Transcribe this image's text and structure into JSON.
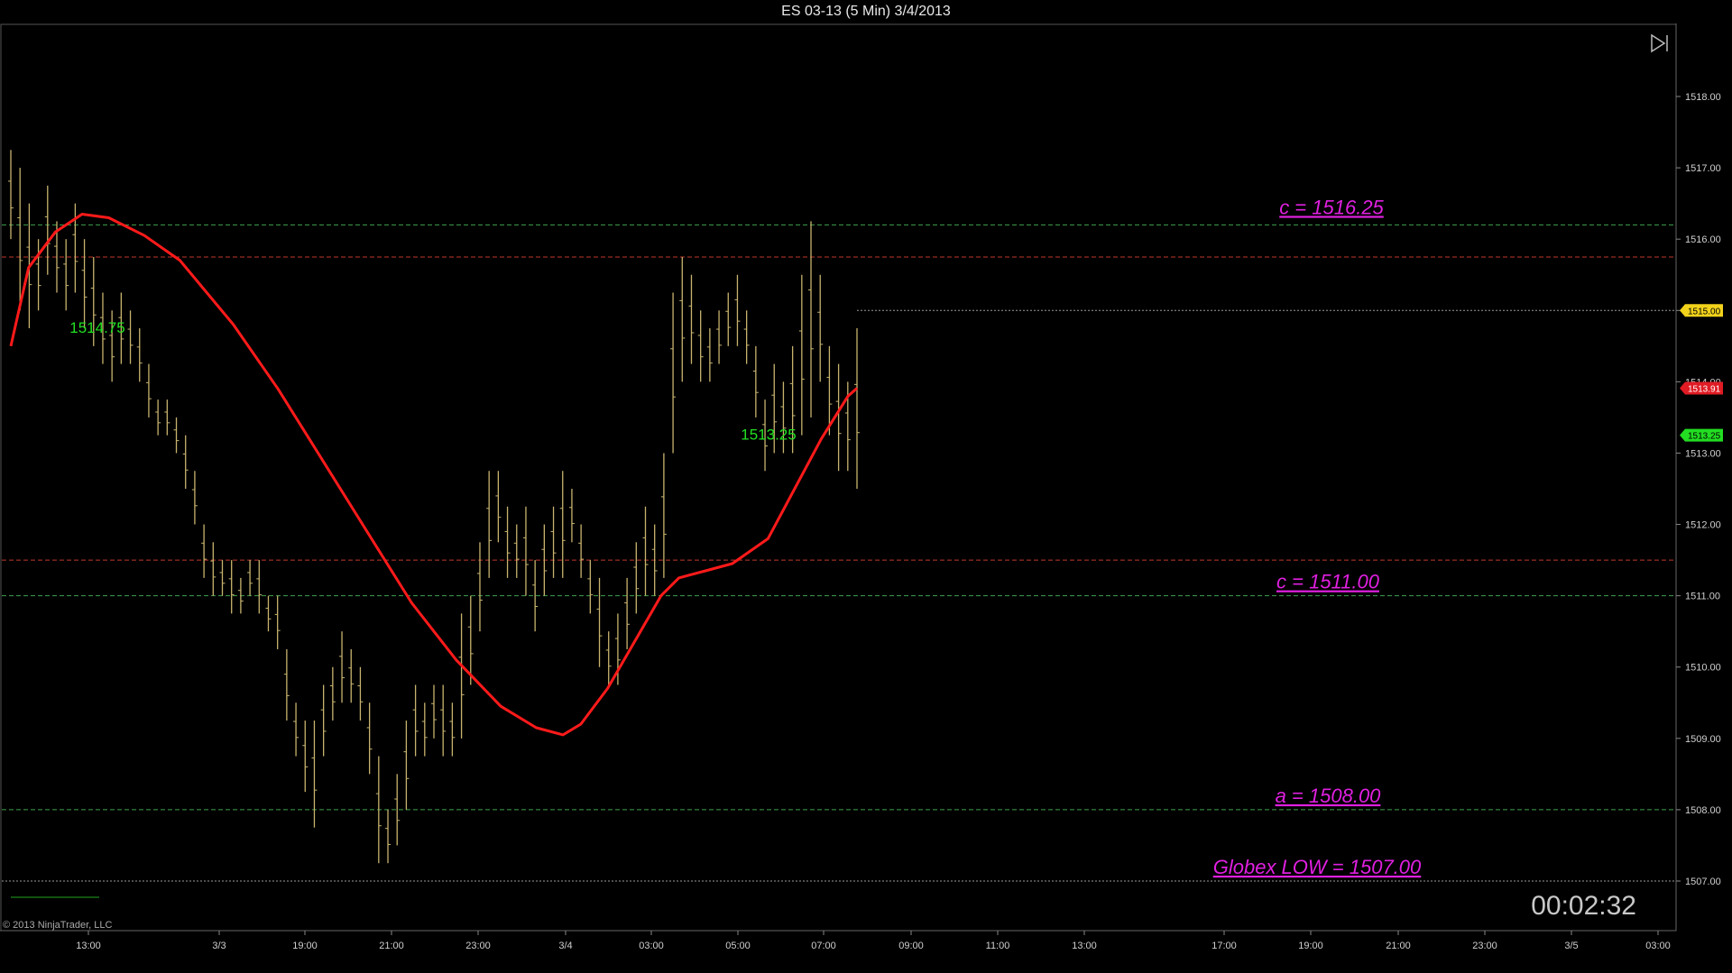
{
  "window": {
    "title": "ES 03-13 (5 Min)  3/4/2013"
  },
  "clock": "00:02:32",
  "copyright": "© 2013 NinjaTrader, LLC",
  "colors": {
    "background": "#000000",
    "bars": "#c8b46e",
    "ma": "#ff1a1a",
    "green_line": "#3fa34d",
    "red_line": "#c0392b",
    "annotation": "#e020e0",
    "value_label": "#22e022",
    "price_tag_last": "#f2d21b",
    "price_tag_ma": "#e01b24",
    "price_tag_green": "#22dd22"
  },
  "icons": {
    "nav": "skip-to-end-icon"
  },
  "chart_data": {
    "type": "bar",
    "instrument": "ES 03-13",
    "interval": "5 Min",
    "ylim": [
      1506.3,
      1518.7
    ],
    "y_ticks": [
      "1507.00",
      "1508.00",
      "1509.00",
      "1510.00",
      "1511.00",
      "1512.00",
      "1513.00",
      "1514.00",
      "1515.00",
      "1516.00",
      "1517.00",
      "1518.00"
    ],
    "x_ticks": [
      "13:00",
      "3/3",
      "19:00",
      "21:00",
      "23:00",
      "3/4",
      "03:00",
      "05:00",
      "07:00",
      "09:00",
      "11:00",
      "13:00",
      "17:00",
      "19:00",
      "21:00",
      "23:00",
      "3/5",
      "03:00"
    ],
    "price_bars_sketch": [
      [
        1517.25,
        1516.0
      ],
      [
        1517.0,
        1515.0
      ],
      [
        1516.5,
        1514.75
      ],
      [
        1516.0,
        1515.0
      ],
      [
        1516.75,
        1515.5
      ],
      [
        1516.25,
        1515.25
      ],
      [
        1516.0,
        1515.0
      ],
      [
        1516.5,
        1515.25
      ],
      [
        1516.0,
        1514.75
      ],
      [
        1515.75,
        1514.5
      ],
      [
        1515.25,
        1514.25
      ],
      [
        1515.0,
        1514.0
      ],
      [
        1515.25,
        1514.25
      ],
      [
        1515.0,
        1514.25
      ],
      [
        1514.75,
        1514.0
      ],
      [
        1514.25,
        1513.5
      ],
      [
        1513.75,
        1513.25
      ],
      [
        1513.75,
        1513.25
      ],
      [
        1513.5,
        1513.0
      ],
      [
        1513.25,
        1512.5
      ],
      [
        1512.75,
        1512.0
      ],
      [
        1512.0,
        1511.25
      ],
      [
        1511.75,
        1511.0
      ],
      [
        1511.5,
        1511.0
      ],
      [
        1511.5,
        1510.75
      ],
      [
        1511.25,
        1510.75
      ],
      [
        1511.5,
        1511.0
      ],
      [
        1511.5,
        1510.75
      ],
      [
        1511.0,
        1510.5
      ],
      [
        1511.0,
        1510.25
      ],
      [
        1510.25,
        1509.25
      ],
      [
        1509.5,
        1508.75
      ],
      [
        1509.25,
        1508.25
      ],
      [
        1509.25,
        1507.75
      ],
      [
        1509.75,
        1508.75
      ],
      [
        1510.0,
        1509.25
      ],
      [
        1510.5,
        1509.5
      ],
      [
        1510.25,
        1509.5
      ],
      [
        1510.0,
        1509.25
      ],
      [
        1509.5,
        1508.5
      ],
      [
        1508.75,
        1507.25
      ],
      [
        1508.0,
        1507.25
      ],
      [
        1508.5,
        1507.5
      ],
      [
        1509.25,
        1508.0
      ],
      [
        1509.75,
        1508.75
      ],
      [
        1509.5,
        1508.75
      ],
      [
        1509.75,
        1509.0
      ],
      [
        1509.75,
        1508.75
      ],
      [
        1509.5,
        1508.75
      ],
      [
        1510.75,
        1509.0
      ],
      [
        1511.0,
        1509.75
      ],
      [
        1511.75,
        1510.5
      ],
      [
        1512.75,
        1511.25
      ],
      [
        1512.75,
        1511.75
      ],
      [
        1512.25,
        1511.25
      ],
      [
        1512.0,
        1511.25
      ],
      [
        1512.25,
        1511.0
      ],
      [
        1511.5,
        1510.5
      ],
      [
        1512.0,
        1511.0
      ],
      [
        1512.25,
        1511.25
      ],
      [
        1512.75,
        1511.25
      ],
      [
        1512.5,
        1511.75
      ],
      [
        1512.0,
        1511.25
      ],
      [
        1511.5,
        1510.75
      ],
      [
        1511.25,
        1510.0
      ],
      [
        1510.5,
        1509.75
      ],
      [
        1510.75,
        1509.75
      ],
      [
        1511.25,
        1510.25
      ],
      [
        1511.75,
        1510.75
      ],
      [
        1512.25,
        1511.0
      ],
      [
        1512.0,
        1511.0
      ],
      [
        1513.0,
        1511.25
      ],
      [
        1515.25,
        1513.0
      ],
      [
        1515.75,
        1514.0
      ],
      [
        1515.5,
        1514.25
      ],
      [
        1515.0,
        1514.0
      ],
      [
        1514.75,
        1514.0
      ],
      [
        1515.0,
        1514.25
      ],
      [
        1515.25,
        1514.5
      ],
      [
        1515.5,
        1514.5
      ],
      [
        1515.0,
        1514.25
      ],
      [
        1514.5,
        1513.5
      ],
      [
        1513.75,
        1512.75
      ],
      [
        1514.25,
        1513.0
      ],
      [
        1514.0,
        1513.0
      ],
      [
        1514.5,
        1513.0
      ],
      [
        1515.5,
        1513.25
      ],
      [
        1516.25,
        1513.5
      ],
      [
        1515.5,
        1514.0
      ],
      [
        1514.5,
        1513.25
      ],
      [
        1514.25,
        1512.75
      ],
      [
        1514.0,
        1512.75
      ],
      [
        1514.75,
        1512.5
      ]
    ],
    "series": [
      {
        "type": "line",
        "values_sketch": [
          [
            0,
            1514.5
          ],
          [
            4,
            1515.6
          ],
          [
            10,
            1516.1
          ],
          [
            16,
            1516.35
          ],
          [
            22,
            1516.3
          ],
          [
            30,
            1516.05
          ],
          [
            38,
            1515.7
          ],
          [
            50,
            1514.8
          ],
          [
            60,
            1513.9
          ],
          [
            70,
            1512.9
          ],
          [
            80,
            1511.9
          ],
          [
            90,
            1510.9
          ],
          [
            100,
            1510.1
          ],
          [
            110,
            1509.45
          ],
          [
            118,
            1509.15
          ],
          [
            124,
            1509.05
          ],
          [
            128,
            1509.2
          ],
          [
            134,
            1509.7
          ],
          [
            140,
            1510.35
          ],
          [
            146,
            1511.0
          ],
          [
            150,
            1511.25
          ],
          [
            156,
            1511.35
          ],
          [
            162,
            1511.45
          ],
          [
            170,
            1511.8
          ],
          [
            176,
            1512.5
          ],
          [
            182,
            1513.2
          ],
          [
            188,
            1513.8
          ],
          [
            190,
            1513.91
          ]
        ]
      }
    ],
    "horizontal_lines": [
      {
        "price": 1516.2,
        "style": "green-dashed"
      },
      {
        "price": 1515.75,
        "style": "red-dashed"
      },
      {
        "price": 1515.0,
        "style": "gray-dotted"
      },
      {
        "price": 1511.5,
        "style": "red-dashed"
      },
      {
        "price": 1511.0,
        "style": "green-dashed"
      },
      {
        "price": 1508.0,
        "style": "green-dashed"
      },
      {
        "price": 1507.0,
        "style": "gray-dotted"
      }
    ],
    "annotations": [
      {
        "text": "c = 1516.25",
        "price": 1516.25
      },
      {
        "text": "c = 1511.00",
        "price": 1511.0
      },
      {
        "text": "a = 1508.00",
        "price": 1508.0
      },
      {
        "text": "Globex LOW = 1507.00",
        "price": 1507.0
      }
    ],
    "value_labels": [
      {
        "text": "1514.75",
        "price": 1514.75
      },
      {
        "text": "1513.25",
        "price": 1513.25
      }
    ],
    "price_tags": [
      {
        "text": "1515.00",
        "price": 1515.0,
        "kind": "last"
      },
      {
        "text": "1513.91",
        "price": 1513.91,
        "kind": "ma"
      },
      {
        "text": "1513.25",
        "price": 1513.25,
        "kind": "green"
      }
    ]
  }
}
